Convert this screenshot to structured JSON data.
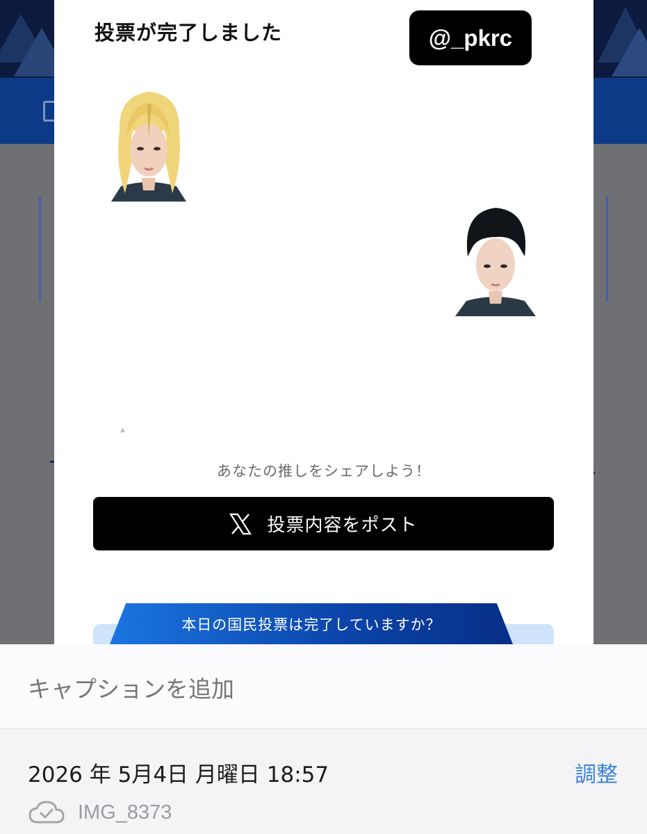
{
  "modal": {
    "title": "投票が完了しました",
    "handle": "@_pkrc",
    "share_prompt": "あなたの推しをシェアしよう！",
    "post_button_label": "投票内容をポスト",
    "vote_banner": "本日の国民投票は完了していますか？"
  },
  "icons": {
    "post_button": "x-logo-icon",
    "file_status": "cloud-check-icon"
  },
  "colors": {
    "modal_button": "#000000",
    "banner": "#0b43a8",
    "link": "#3b82d8"
  },
  "sheet": {
    "caption_placeholder": "キャプションを追加",
    "datetime": "2026 年 5月4日 月曜日 18:57",
    "adjust_label": "調整",
    "file_name": "IMG_8373"
  }
}
